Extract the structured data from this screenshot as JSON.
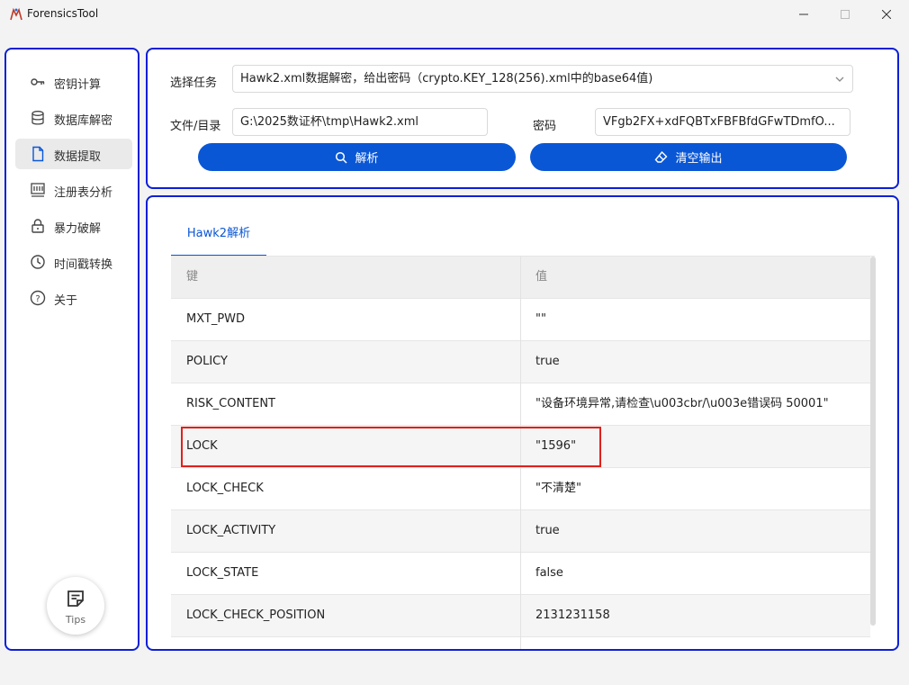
{
  "window": {
    "title": "ForensicsTool"
  },
  "sidebar": {
    "items": [
      {
        "label": "密钥计算",
        "icon": "key-icon"
      },
      {
        "label": "数据库解密",
        "icon": "database-icon"
      },
      {
        "label": "数据提取",
        "icon": "file-icon",
        "active": true
      },
      {
        "label": "注册表分析",
        "icon": "registry-icon"
      },
      {
        "label": "暴力破解",
        "icon": "lock-icon"
      },
      {
        "label": "时间戳转换",
        "icon": "clock-icon"
      },
      {
        "label": "关于",
        "icon": "help-icon"
      }
    ],
    "tips_label": "Tips"
  },
  "form": {
    "task_label": "选择任务",
    "task_value": "Hawk2.xml数据解密，给出密码（crypto.KEY_128(256).xml中的base64值)",
    "path_label": "文件/目录",
    "path_value": "G:\\2025数证杯\\tmp\\Hawk2.xml",
    "password_label": "密码",
    "password_value": "VFgb2FX+xdFQBTxFBFBfdGFwTDmfO...",
    "parse_button": "解析",
    "clear_button": "清空输出"
  },
  "output": {
    "tab": "Hawk2解析",
    "columns": [
      "键",
      "值"
    ],
    "rows": [
      {
        "key": "MXT_PWD",
        "value": "\"\""
      },
      {
        "key": "POLICY",
        "value": "true"
      },
      {
        "key": "RISK_CONTENT",
        "value": "\"设备环境异常,请检查\\u003cbr/\\u003e错误码 50001\""
      },
      {
        "key": "LOCK",
        "value": "\"1596\""
      },
      {
        "key": "LOCK_CHECK",
        "value": "\"不清楚\""
      },
      {
        "key": "LOCK_ACTIVITY",
        "value": "true"
      },
      {
        "key": "LOCK_STATE",
        "value": "false"
      },
      {
        "key": "LOCK_CHECK_POSITION",
        "value": "2131231158"
      },
      {
        "key": "",
        "value": ""
      }
    ]
  },
  "colors": {
    "accent": "#0a57d6",
    "panel_outline": "#0b1fd6",
    "highlight": "#e0201c"
  }
}
